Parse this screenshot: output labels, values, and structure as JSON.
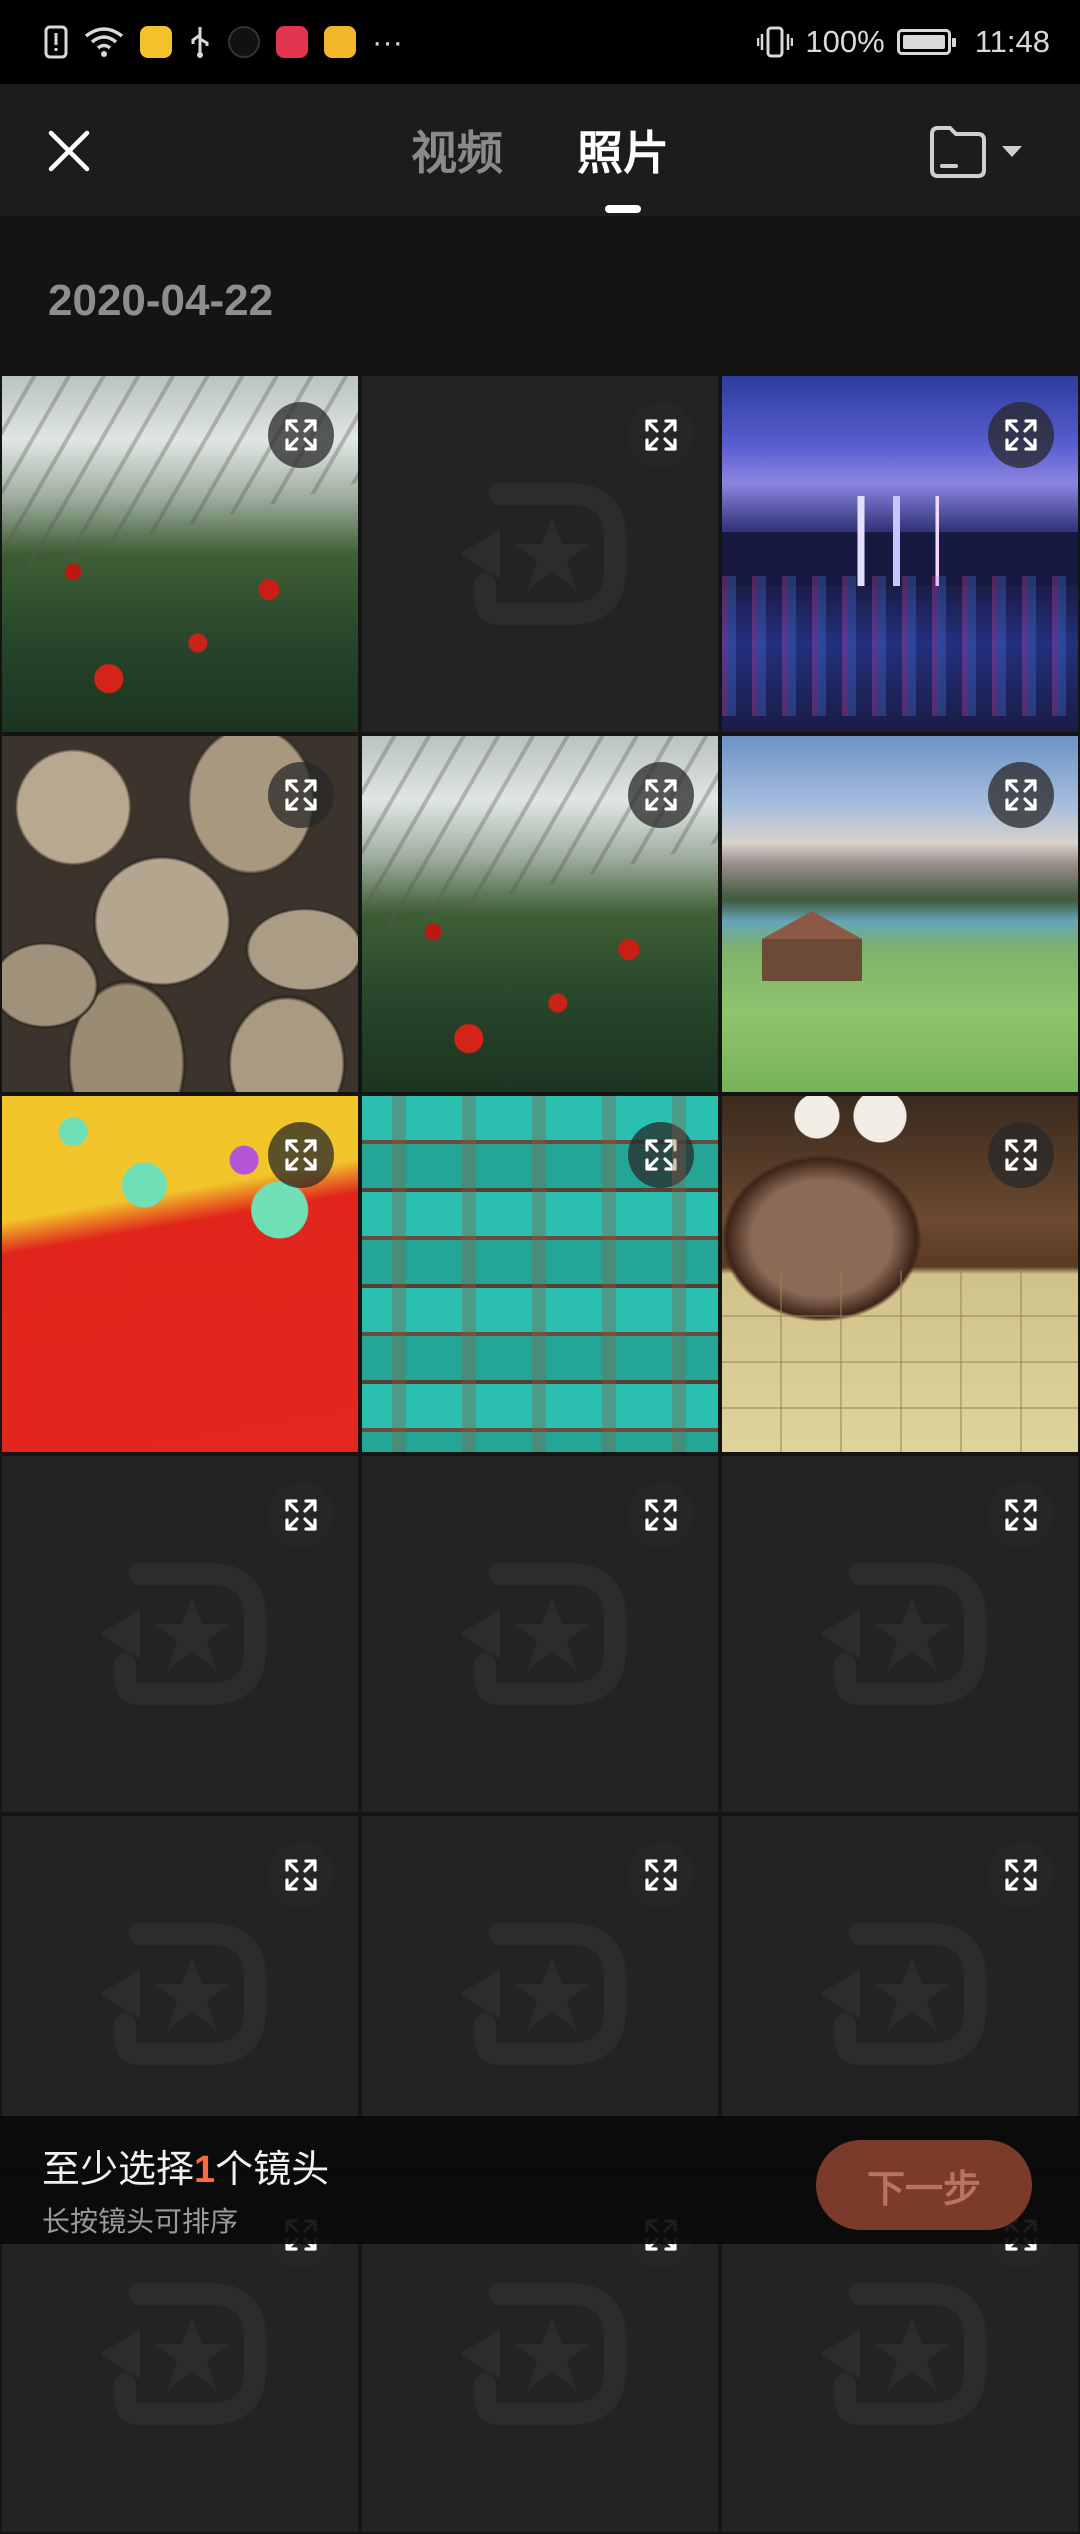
{
  "status_bar": {
    "battery_text": "100%",
    "time": "11:48",
    "more_indicator": "···",
    "battery_level": 1.0
  },
  "header": {
    "close_icon": "close-icon",
    "tabs": [
      {
        "label": "视频",
        "active": false
      },
      {
        "label": "照片",
        "active": true
      }
    ],
    "folder_icon": "folder-icon"
  },
  "date_group": "2020-04-22",
  "grid": {
    "items": [
      {
        "kind": "photo",
        "scene": "greenhouse"
      },
      {
        "kind": "placeholder"
      },
      {
        "kind": "photo",
        "scene": "city-night"
      },
      {
        "kind": "photo",
        "scene": "stone-wall"
      },
      {
        "kind": "photo",
        "scene": "greenhouse"
      },
      {
        "kind": "photo",
        "scene": "mountain-landscape"
      },
      {
        "kind": "photo",
        "scene": "red-floral"
      },
      {
        "kind": "photo",
        "scene": "teal-wood"
      },
      {
        "kind": "photo",
        "scene": "vase-floor"
      },
      {
        "kind": "placeholder"
      },
      {
        "kind": "placeholder"
      },
      {
        "kind": "placeholder"
      },
      {
        "kind": "placeholder"
      },
      {
        "kind": "placeholder"
      },
      {
        "kind": "placeholder"
      },
      {
        "kind": "placeholder"
      },
      {
        "kind": "placeholder"
      },
      {
        "kind": "placeholder"
      }
    ],
    "preview_icon": "expand-icon"
  },
  "bottom_bar": {
    "hint_prefix": "至少选择",
    "hint_count": "1",
    "hint_suffix": "个镜头",
    "sub_hint": "长按镜头可排序",
    "next_label": "下一步"
  },
  "colors": {
    "accent": "#ff6a3d",
    "next_button_bg": "#7a3b2b",
    "next_button_text": "#b9735f"
  }
}
